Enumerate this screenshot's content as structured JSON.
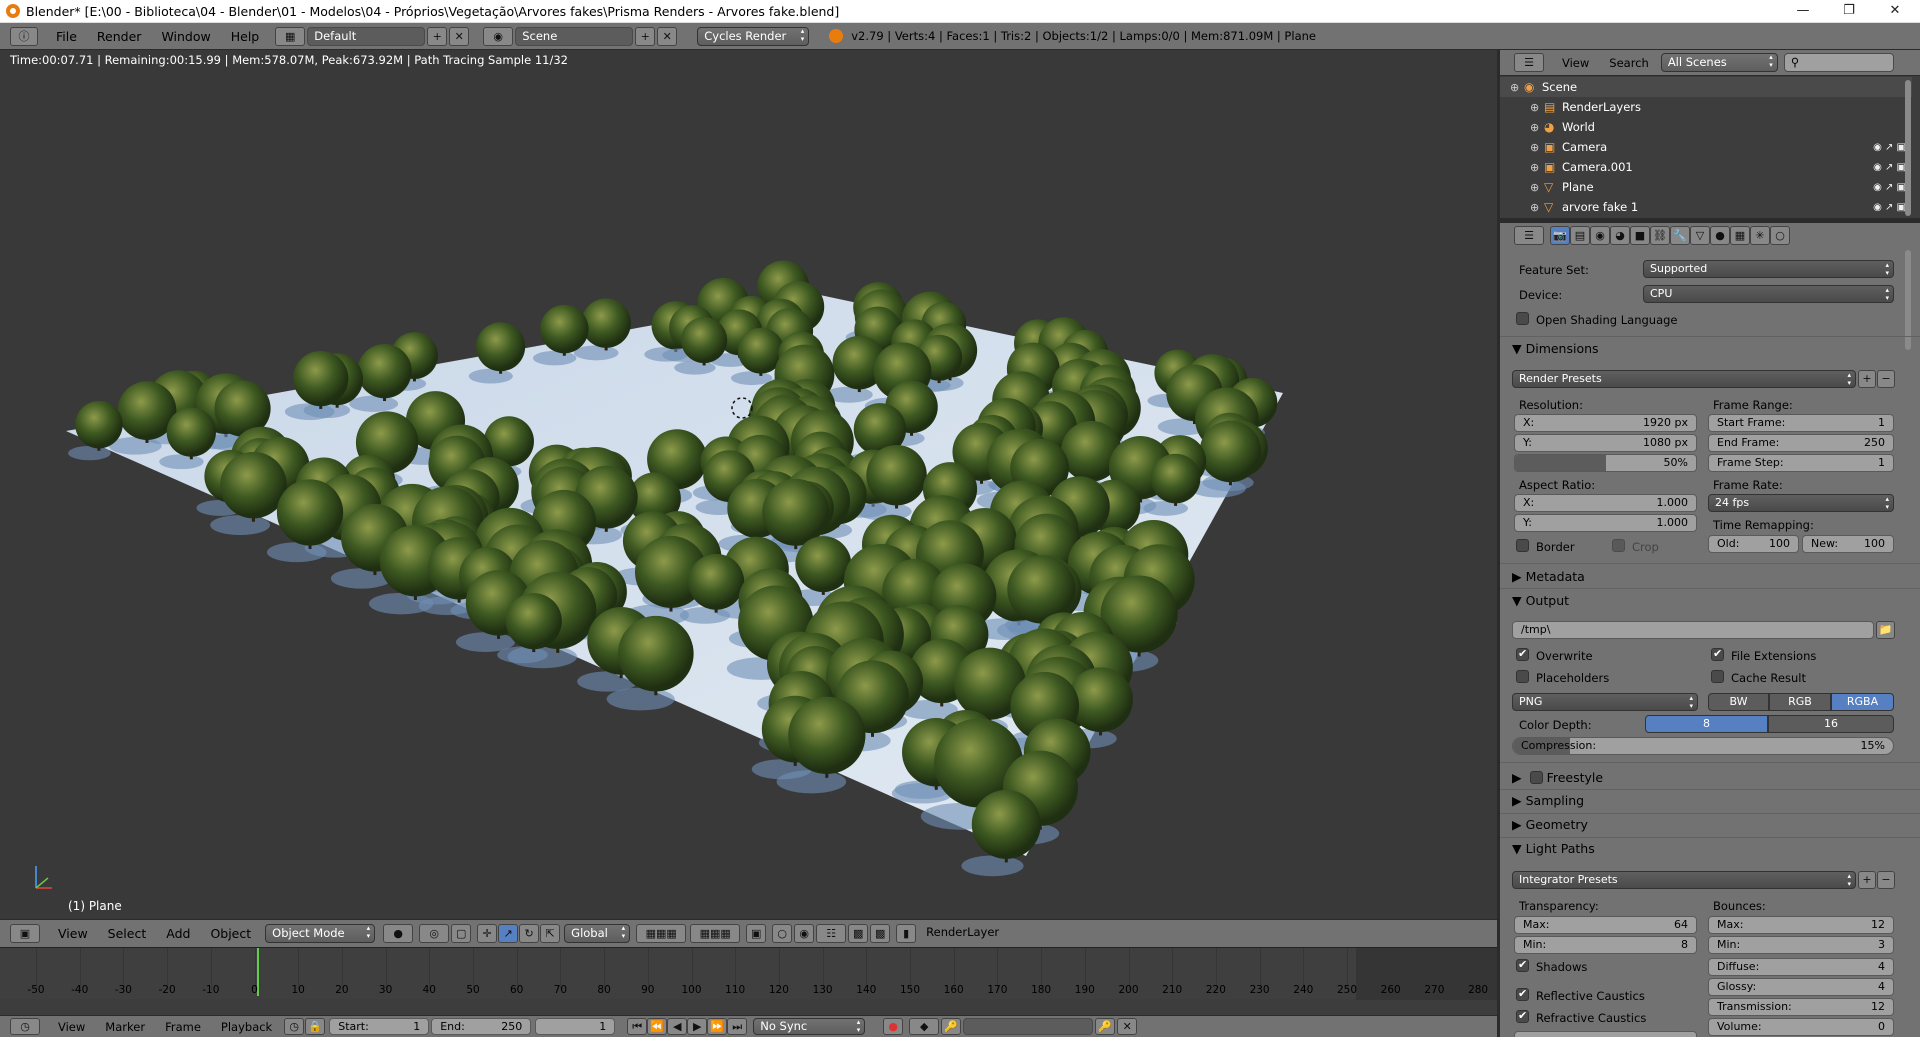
{
  "window": {
    "title": "Blender* [E:\\00 - Biblioteca\\04 - Blender\\01 - Modelos\\04 - Próprios\\Vegetação\\Arvores fakes\\Prisma Renders - Arvores fake.blend]",
    "controls": {
      "minimize": "—",
      "maximize": "❐",
      "close": "✕"
    }
  },
  "info_header": {
    "menus": [
      "File",
      "Render",
      "Window",
      "Help"
    ],
    "layout": "Default",
    "scene": "Scene",
    "engine": "Cycles Render",
    "stats": "v2.79 | Verts:4 | Faces:1 | Tris:2 | Objects:1/2 | Lamps:0/0 | Mem:871.09M | Plane"
  },
  "viewport": {
    "render_info": "Time:00:07.71 | Remaining:00:15.99 | Mem:578.07M, Peak:673.92M | Path Tracing Sample 11/32",
    "object_name": "(1) Plane"
  },
  "view3d_header": {
    "menus": [
      "View",
      "Select",
      "Add",
      "Object"
    ],
    "mode": "Object Mode",
    "orientation": "Global",
    "render_layer": "RenderLayer"
  },
  "timeline": {
    "ticks": [
      "-50",
      "-40",
      "-30",
      "-20",
      "-10",
      "0",
      "10",
      "20",
      "30",
      "40",
      "50",
      "60",
      "70",
      "80",
      "90",
      "100",
      "110",
      "120",
      "130",
      "140",
      "150",
      "160",
      "170",
      "180",
      "190",
      "200",
      "210",
      "220",
      "230",
      "240",
      "250",
      "260",
      "270",
      "280"
    ],
    "menus": [
      "View",
      "Marker",
      "Frame",
      "Playback"
    ],
    "start_label": "Start:",
    "start_value": "1",
    "end_label": "End:",
    "end_value": "250",
    "current_frame": "1",
    "sync": "No Sync"
  },
  "outliner": {
    "menus": [
      "View",
      "Search"
    ],
    "filter": "All Scenes",
    "items": [
      {
        "label": "Scene",
        "icon": "scene-icon"
      },
      {
        "label": "RenderLayers",
        "icon": "renderlayers-icon"
      },
      {
        "label": "World",
        "icon": "world-icon"
      },
      {
        "label": "Camera",
        "icon": "camera-icon"
      },
      {
        "label": "Camera.001",
        "icon": "camera-icon"
      },
      {
        "label": "Plane",
        "icon": "mesh-icon"
      },
      {
        "label": "arvore fake 1",
        "icon": "mesh-icon"
      }
    ]
  },
  "properties": {
    "feature_set_label": "Feature Set:",
    "feature_set": "Supported",
    "device_label": "Device:",
    "device": "CPU",
    "osl_label": "Open Shading Language",
    "dimensions": {
      "title": "Dimensions",
      "presets": "Render Presets",
      "resolution_label": "Resolution:",
      "res_x_label": "X:",
      "res_x": "1920 px",
      "res_y_label": "Y:",
      "res_y": "1080 px",
      "res_pct": "50%",
      "res_pct_fraction": 0.5,
      "frame_range_label": "Frame Range:",
      "start_label": "Start Frame:",
      "start": "1",
      "end_label": "End Frame:",
      "end": "250",
      "step_label": "Frame Step:",
      "step": "1",
      "aspect_label": "Aspect Ratio:",
      "asp_x_label": "X:",
      "asp_x": "1.000",
      "asp_y_label": "Y:",
      "asp_y": "1.000",
      "frame_rate_label": "Frame Rate:",
      "frame_rate": "24 fps",
      "time_remap_label": "Time Remapping:",
      "old_label": "Old:",
      "old": "100",
      "new_label": "New:",
      "new": "100",
      "border_label": "Border",
      "crop_label": "Crop"
    },
    "metadata_title": "Metadata",
    "output": {
      "title": "Output",
      "path": "/tmp\\",
      "overwrite": "Overwrite",
      "file_ext": "File Extensions",
      "placeholders": "Placeholders",
      "cache": "Cache Result",
      "format": "PNG",
      "bw": "BW",
      "rgb": "RGB",
      "rgba": "RGBA",
      "color_depth_label": "Color Depth:",
      "depth8": "8",
      "depth16": "16",
      "compression_label": "Compression:",
      "compression": "15%",
      "compression_fraction": 0.15
    },
    "freestyle_title": "Freestyle",
    "sampling_title": "Sampling",
    "geometry_title": "Geometry",
    "light_paths": {
      "title": "Light Paths",
      "presets": "Integrator Presets",
      "transparency_label": "Transparency:",
      "t_max_label": "Max:",
      "t_max": "64",
      "t_min_label": "Min:",
      "t_min": "8",
      "bounces_label": "Bounces:",
      "b_max_label": "Max:",
      "b_max": "12",
      "b_min_label": "Min:",
      "b_min": "3",
      "shadows": "Shadows",
      "reflective": "Reflective Caustics",
      "refractive": "Refractive Caustics",
      "diffuse_label": "Diffuse:",
      "diffuse": "4",
      "glossy_label": "Glossy:",
      "glossy": "4",
      "transmission_label": "Transmission:",
      "transmission": "12",
      "volume_label": "Volume:",
      "volume": "0"
    }
  }
}
